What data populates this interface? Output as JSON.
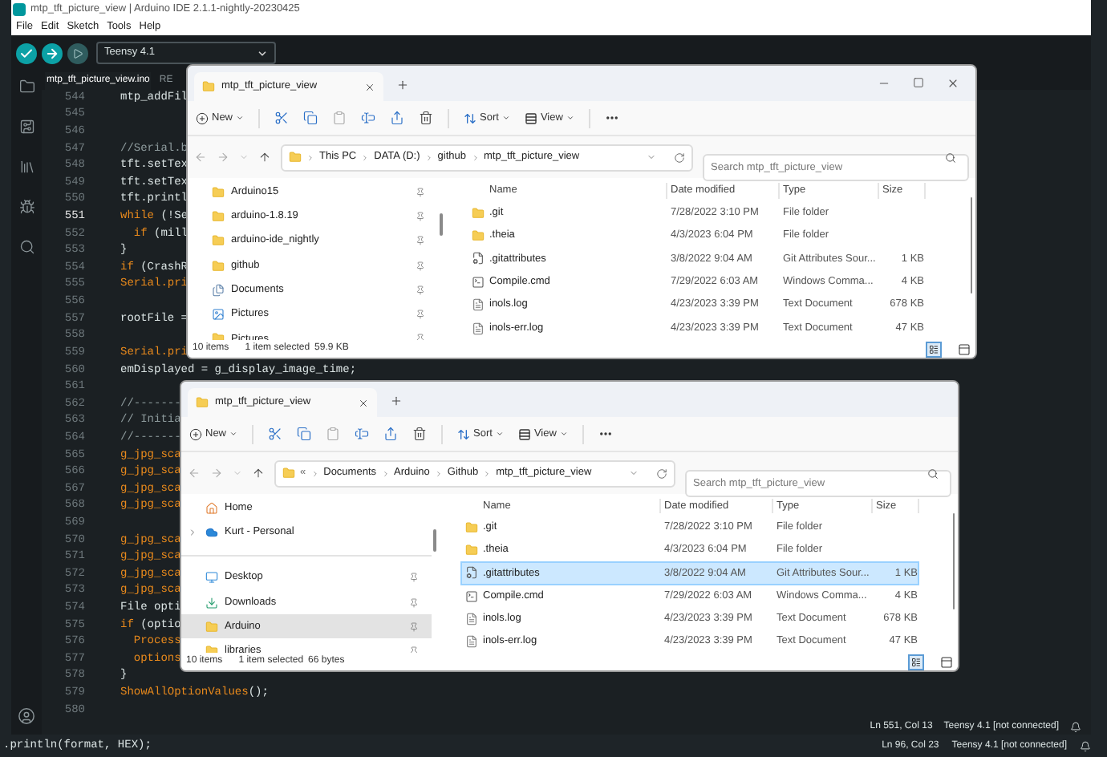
{
  "ide": {
    "title": "mtp_tft_picture_view | Arduino IDE 2.1.1-nightly-20230425",
    "menu": [
      "File",
      "Edit",
      "Sketch",
      "Tools",
      "Help"
    ],
    "board": "Teensy 4.1",
    "tabs": [
      {
        "label": "mtp_tft_picture_view.ino",
        "selected": true
      },
      {
        "label": "RE",
        "selected": false
      }
    ],
    "lines": [
      {
        "number": "544",
        "current": false,
        "parts": [
          {
            "text": "mtp_addFil",
            "kind": "plain"
          }
        ]
      },
      {
        "number": "545",
        "current": false
      },
      {
        "number": "546",
        "current": false
      },
      {
        "number": "547",
        "current": false,
        "parts": [
          {
            "text": "//Serial.b",
            "kind": "comment"
          }
        ]
      },
      {
        "number": "548",
        "current": false,
        "parts": [
          {
            "text": "tft.setTex",
            "kind": "plain"
          }
        ]
      },
      {
        "number": "549",
        "current": false,
        "parts": [
          {
            "text": "tft.setTex",
            "kind": "plain"
          }
        ]
      },
      {
        "number": "550",
        "current": false,
        "parts": [
          {
            "text": "tft.printl",
            "kind": "plain"
          }
        ]
      },
      {
        "number": "551",
        "current": true,
        "parts": [
          {
            "text": "while",
            "kind": "accent"
          },
          {
            "text": " (!Se",
            "kind": "plain"
          }
        ]
      },
      {
        "number": "552",
        "current": false,
        "parts": [
          {
            "text": "  if",
            "kind": "accent"
          },
          {
            "text": " (mill",
            "kind": "plain"
          }
        ]
      },
      {
        "number": "553",
        "current": false,
        "parts": [
          {
            "text": "}",
            "kind": "plain"
          }
        ]
      },
      {
        "number": "554",
        "current": false,
        "parts": [
          {
            "text": "if",
            "kind": "accent"
          },
          {
            "text": " (CrashR",
            "kind": "plain"
          }
        ]
      },
      {
        "number": "555",
        "current": false,
        "parts": [
          {
            "text": "Serial.pri",
            "kind": "accent"
          }
        ]
      },
      {
        "number": "556",
        "current": false
      },
      {
        "number": "557",
        "current": false,
        "parts": [
          {
            "text": "rootFile =",
            "kind": "plain"
          }
        ]
      },
      {
        "number": "558",
        "current": false
      },
      {
        "number": "559",
        "current": false,
        "parts": [
          {
            "text": "Serial.pri",
            "kind": "accent"
          }
        ]
      },
      {
        "number": "560",
        "current": false,
        "parts": [
          {
            "text": "emDisplayed = g_display_image_time;",
            "kind": "plain"
          }
        ]
      },
      {
        "number": "561",
        "current": false
      },
      {
        "number": "562",
        "current": false,
        "parts": [
          {
            "text": "//-------",
            "kind": "comment"
          }
        ]
      },
      {
        "number": "563",
        "current": false,
        "parts": [
          {
            "text": "// Initia",
            "kind": "comment"
          }
        ]
      },
      {
        "number": "564",
        "current": false,
        "parts": [
          {
            "text": "//-------",
            "kind": "comment"
          }
        ]
      },
      {
        "number": "565",
        "current": false,
        "parts": [
          {
            "text": "g_jpg_sca",
            "kind": "accent"
          }
        ]
      },
      {
        "number": "566",
        "current": false,
        "parts": [
          {
            "text": "g_jpg_sca",
            "kind": "accent"
          }
        ]
      },
      {
        "number": "567",
        "current": false,
        "parts": [
          {
            "text": "g_jpg_sca",
            "kind": "accent"
          }
        ]
      },
      {
        "number": "568",
        "current": false,
        "parts": [
          {
            "text": "g_jpg_sca",
            "kind": "accent"
          }
        ]
      },
      {
        "number": "569",
        "current": false
      },
      {
        "number": "570",
        "current": false,
        "parts": [
          {
            "text": "g_jpg_sca",
            "kind": "accent"
          }
        ]
      },
      {
        "number": "571",
        "current": false,
        "parts": [
          {
            "text": "g_jpg_sca",
            "kind": "accent"
          }
        ]
      },
      {
        "number": "572",
        "current": false,
        "parts": [
          {
            "text": "g_jpg_sca",
            "kind": "accent"
          }
        ]
      },
      {
        "number": "573",
        "current": false,
        "parts": [
          {
            "text": "g_jpg_sca",
            "kind": "accent"
          }
        ]
      },
      {
        "number": "574",
        "current": false,
        "parts": [
          {
            "text": "File opti",
            "kind": "plain"
          }
        ]
      },
      {
        "number": "575",
        "current": false,
        "parts": [
          {
            "text": "if",
            "kind": "accent"
          },
          {
            "text": " (optio",
            "kind": "plain"
          }
        ]
      },
      {
        "number": "576",
        "current": false,
        "parts": [
          {
            "text": "  Process",
            "kind": "accent"
          }
        ]
      },
      {
        "number": "577",
        "current": false,
        "parts": [
          {
            "text": "  options",
            "kind": "accent"
          }
        ]
      },
      {
        "number": "578",
        "current": false,
        "parts": [
          {
            "text": "}",
            "kind": "plain"
          }
        ]
      },
      {
        "number": "579",
        "current": false,
        "parts": [
          {
            "text": "ShowAllOptionValues",
            "kind": "accent"
          },
          {
            "text": "();",
            "kind": "plain"
          }
        ]
      },
      {
        "number": "580",
        "current": false
      }
    ],
    "status": {
      "position": "Ln 551, Col 13",
      "board": "Teensy 4.1 [not connected]"
    }
  },
  "explorers": [
    {
      "tab": "mtp_tft_picture_view",
      "window_controls": true,
      "commands": [
        "New",
        "Sort",
        "View"
      ],
      "path": [
        "This PC",
        "DATA (D:)",
        "github",
        "mtp_tft_picture_view"
      ],
      "search_placeholder": "Search mtp_tft_picture_view",
      "nav": [
        [
          {
            "label": "Arduino15",
            "kind": "folder",
            "pinned": true,
            "expandable": false,
            "selected": false
          },
          {
            "label": "arduino-1.8.19",
            "kind": "folder",
            "pinned": true,
            "expandable": false,
            "selected": false
          },
          {
            "label": "arduino-ide_nightly",
            "kind": "folder",
            "pinned": true,
            "expandable": false,
            "selected": false
          },
          {
            "label": "github",
            "kind": "folder",
            "pinned": true,
            "expandable": false,
            "selected": false
          },
          {
            "label": "Documents",
            "kind": "documents",
            "pinned": true,
            "expandable": false,
            "selected": false
          },
          {
            "label": "Pictures",
            "kind": "pictures",
            "pinned": true,
            "expandable": false,
            "selected": false
          },
          {
            "label": "Pictures",
            "kind": "folder",
            "pinned": true,
            "expandable": false,
            "selected": false
          }
        ]
      ],
      "columns": [
        "Name",
        "Date modified",
        "Type",
        "Size"
      ],
      "files": [
        {
          "name": ".git",
          "date": "7/28/2022 3:10 PM",
          "type": "File folder",
          "kind": "folder",
          "selected": false
        },
        {
          "name": ".theia",
          "date": "4/3/2023 6:04 PM",
          "type": "File folder",
          "kind": "folder",
          "selected": false
        },
        {
          "name": ".gitattributes",
          "date": "3/8/2022 9:04 AM",
          "type": "Git Attributes Sour...",
          "size": "1 KB",
          "kind": "config",
          "selected": false
        },
        {
          "name": "Compile.cmd",
          "date": "7/29/2022 6:03 AM",
          "type": "Windows Comma...",
          "size": "4 KB",
          "kind": "script",
          "selected": false
        },
        {
          "name": "inols.log",
          "date": "4/23/2023 3:39 PM",
          "type": "Text Document",
          "size": "678 KB",
          "kind": "text",
          "selected": false
        },
        {
          "name": "inols-err.log",
          "date": "4/23/2023 3:39 PM",
          "type": "Text Document",
          "size": "47 KB",
          "kind": "text",
          "selected": false
        }
      ],
      "status": {
        "count": "10 items",
        "selection": "1 item selected",
        "size": "59.9 KB"
      }
    },
    {
      "tab": "mtp_tft_picture_view",
      "window_controls": false,
      "commands": [
        "New",
        "Sort",
        "View"
      ],
      "path_prefix": "«",
      "path": [
        "Documents",
        "Arduino",
        "Github",
        "mtp_tft_picture_view"
      ],
      "search_placeholder": "Search mtp_tft_picture_view",
      "nav": [
        [
          {
            "label": "Home",
            "kind": "home",
            "pinned": false,
            "expandable": false,
            "selected": false
          },
          {
            "label": "Kurt - Personal",
            "kind": "cloud",
            "pinned": false,
            "expandable": true,
            "selected": false
          }
        ],
        [
          {
            "label": "Desktop",
            "kind": "desktop",
            "pinned": true,
            "expandable": false,
            "selected": false
          },
          {
            "label": "Downloads",
            "kind": "downloads",
            "pinned": true,
            "expandable": false,
            "selected": false
          },
          {
            "label": "Arduino",
            "kind": "folder",
            "pinned": true,
            "expandable": false,
            "selected": true
          },
          {
            "label": "libraries",
            "kind": "folder",
            "pinned": true,
            "expandable": false,
            "selected": false
          }
        ]
      ],
      "columns": [
        "Name",
        "Date modified",
        "Type",
        "Size"
      ],
      "files": [
        {
          "name": ".git",
          "date": "7/28/2022 3:10 PM",
          "type": "File folder",
          "kind": "folder",
          "selected": false
        },
        {
          "name": ".theia",
          "date": "4/3/2023 6:04 PM",
          "type": "File folder",
          "kind": "folder",
          "selected": false
        },
        {
          "name": ".gitattributes",
          "date": "3/8/2022 9:04 AM",
          "type": "Git Attributes Sour...",
          "size": "1 KB",
          "kind": "config",
          "selected": true
        },
        {
          "name": "Compile.cmd",
          "date": "7/29/2022 6:03 AM",
          "type": "Windows Comma...",
          "size": "4 KB",
          "kind": "script",
          "selected": false
        },
        {
          "name": "inols.log",
          "date": "4/23/2023 3:39 PM",
          "type": "Text Document",
          "size": "678 KB",
          "kind": "text",
          "selected": false
        },
        {
          "name": "inols-err.log",
          "date": "4/23/2023 3:39 PM",
          "type": "Text Document",
          "size": "47 KB",
          "kind": "text",
          "selected": false
        }
      ],
      "status": {
        "count": "10 items",
        "selection": "1 item selected",
        "size": "66 bytes"
      }
    }
  ],
  "background_window": {
    "code": ".println(format, HEX);",
    "status": {
      "position": "Ln 96, Col 23",
      "board": "Teensy 4.1 [not connected]"
    }
  }
}
